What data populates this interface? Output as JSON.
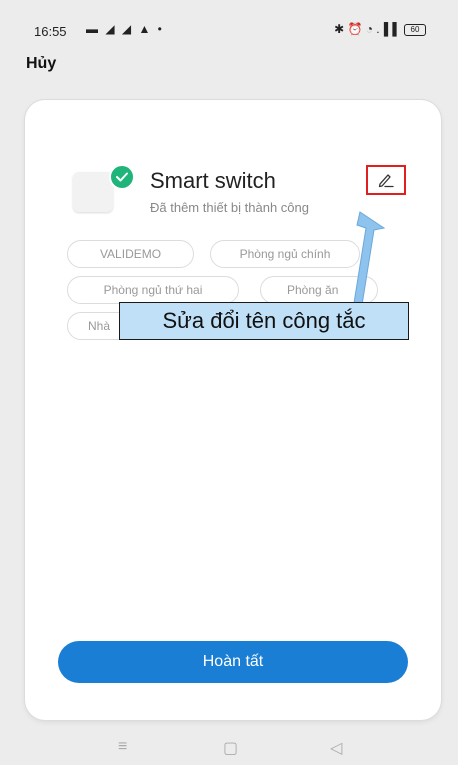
{
  "status_bar": {
    "time": "16:55",
    "left_icons": "▬ ◢ ◢ ▲ •",
    "right_icons": "✱ ⏰ ◔ .▐▐",
    "battery": "60"
  },
  "header": {
    "cancel_label": "Hủy"
  },
  "device": {
    "name": "Smart switch",
    "status": "Đã thêm thiết bị thành công",
    "icon": "smart-switch-icon",
    "success_color": "#1fb47a"
  },
  "rooms": [
    "VALIDEMO",
    "Phòng ngủ chính",
    "Phòng ngủ thứ hai",
    "Phòng ăn",
    "Nhà"
  ],
  "annotation": {
    "text": "Sửa đổi tên công tắc",
    "highlight_color": "#e02020",
    "callout_color": "#bfe0f7"
  },
  "footer": {
    "done_label": "Hoàn tất",
    "accent": "#1a7fd4"
  },
  "nav_bar": {
    "menu": "≡",
    "home": "▢",
    "back": "◁"
  }
}
